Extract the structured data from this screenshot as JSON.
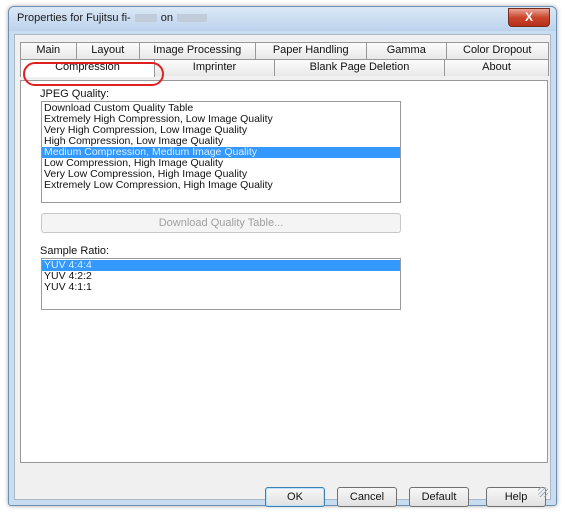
{
  "window": {
    "title_prefix": "Properties for Fujitsu fi-",
    "title_mid": "on",
    "close_symbol": "X"
  },
  "tabs": {
    "row1": [
      "Main",
      "Layout",
      "Image Processing",
      "Paper Handling",
      "Gamma",
      "Color Dropout"
    ],
    "row2": [
      "Compression",
      "Imprinter",
      "Blank Page Deletion",
      "About"
    ],
    "active": "Compression"
  },
  "jpeg_quality": {
    "label": "JPEG Quality:",
    "items": [
      "Download Custom Quality Table",
      "Extremely High Compression, Low Image Quality",
      "Very High Compression, Low Image Quality",
      "High Compression, Low Image Quality",
      "Medium Compression, Medium Image Quality",
      "Low Compression, High Image Quality",
      "Very Low Compression, High Image Quality",
      "Extremely Low Compression, High Image Quality"
    ],
    "selected_index": 4,
    "download_button": "Download Quality Table..."
  },
  "sample_ratio": {
    "label": "Sample Ratio:",
    "items": [
      "YUV 4:4:4",
      "YUV 4:2:2",
      "YUV 4:1:1"
    ],
    "selected_index": 0
  },
  "buttons": {
    "ok": "OK",
    "cancel": "Cancel",
    "default": "Default",
    "help": "Help"
  },
  "colors": {
    "selection": "#3399ff",
    "highlight_ring": "#e02020"
  }
}
